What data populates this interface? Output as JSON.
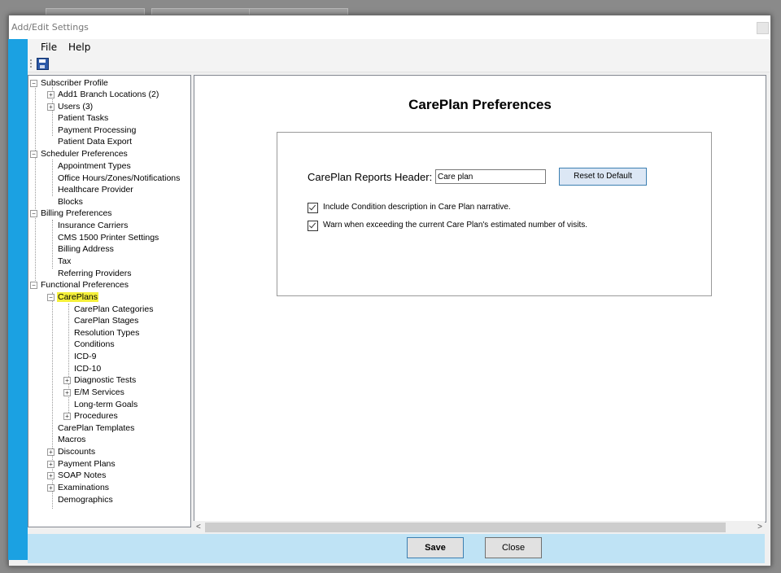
{
  "window": {
    "title": "Add/Edit Settings"
  },
  "menu": {
    "file": "File",
    "help": "Help"
  },
  "toolbar": {
    "save_icon": "save-icon"
  },
  "tree": {
    "subscriber": "Subscriber Profile",
    "add1": "Add1 Branch Locations (2)",
    "users": "Users (3)",
    "patient_tasks": "Patient Tasks",
    "payment_processing": "Payment Processing",
    "patient_data_export": "Patient Data Export",
    "scheduler": "Scheduler Preferences",
    "appointment_types": "Appointment Types",
    "office_hours": "Office Hours/Zones/Notifications",
    "healthcare_provider": "Healthcare Provider",
    "blocks": "Blocks",
    "billing": "Billing Preferences",
    "insurance_carriers": "Insurance Carriers",
    "cms1500": "CMS 1500 Printer Settings",
    "billing_address": "Billing Address",
    "tax": "Tax",
    "referring_providers": "Referring Providers",
    "functional": "Functional Preferences",
    "careplans": "CarePlans",
    "careplan_categories": "CarePlan Categories",
    "careplan_stages": "CarePlan Stages",
    "resolution_types": "Resolution Types",
    "conditions": "Conditions",
    "icd9": "ICD-9",
    "icd10": "ICD-10",
    "diagnostic_tests": "Diagnostic Tests",
    "em_services": "E/M Services",
    "longterm_goals": "Long-term Goals",
    "procedures": "Procedures",
    "careplan_templates": "CarePlan Templates",
    "macros": "Macros",
    "discounts": "Discounts",
    "payment_plans": "Payment Plans",
    "soap_notes": "SOAP Notes",
    "examinations": "Examinations",
    "demographics": "Demographics"
  },
  "main": {
    "title": "CarePlan Preferences",
    "header_label": "CarePlan Reports Header:",
    "header_value": "Care plan",
    "reset_label": "Reset to Default",
    "chk1_label": "Include Condition description in Care Plan narrative.",
    "chk1_checked": true,
    "chk2_label": "Warn when exceeding the current Care Plan's estimated number of visits.",
    "chk2_checked": true
  },
  "footer": {
    "save": "Save",
    "close": "Close"
  }
}
